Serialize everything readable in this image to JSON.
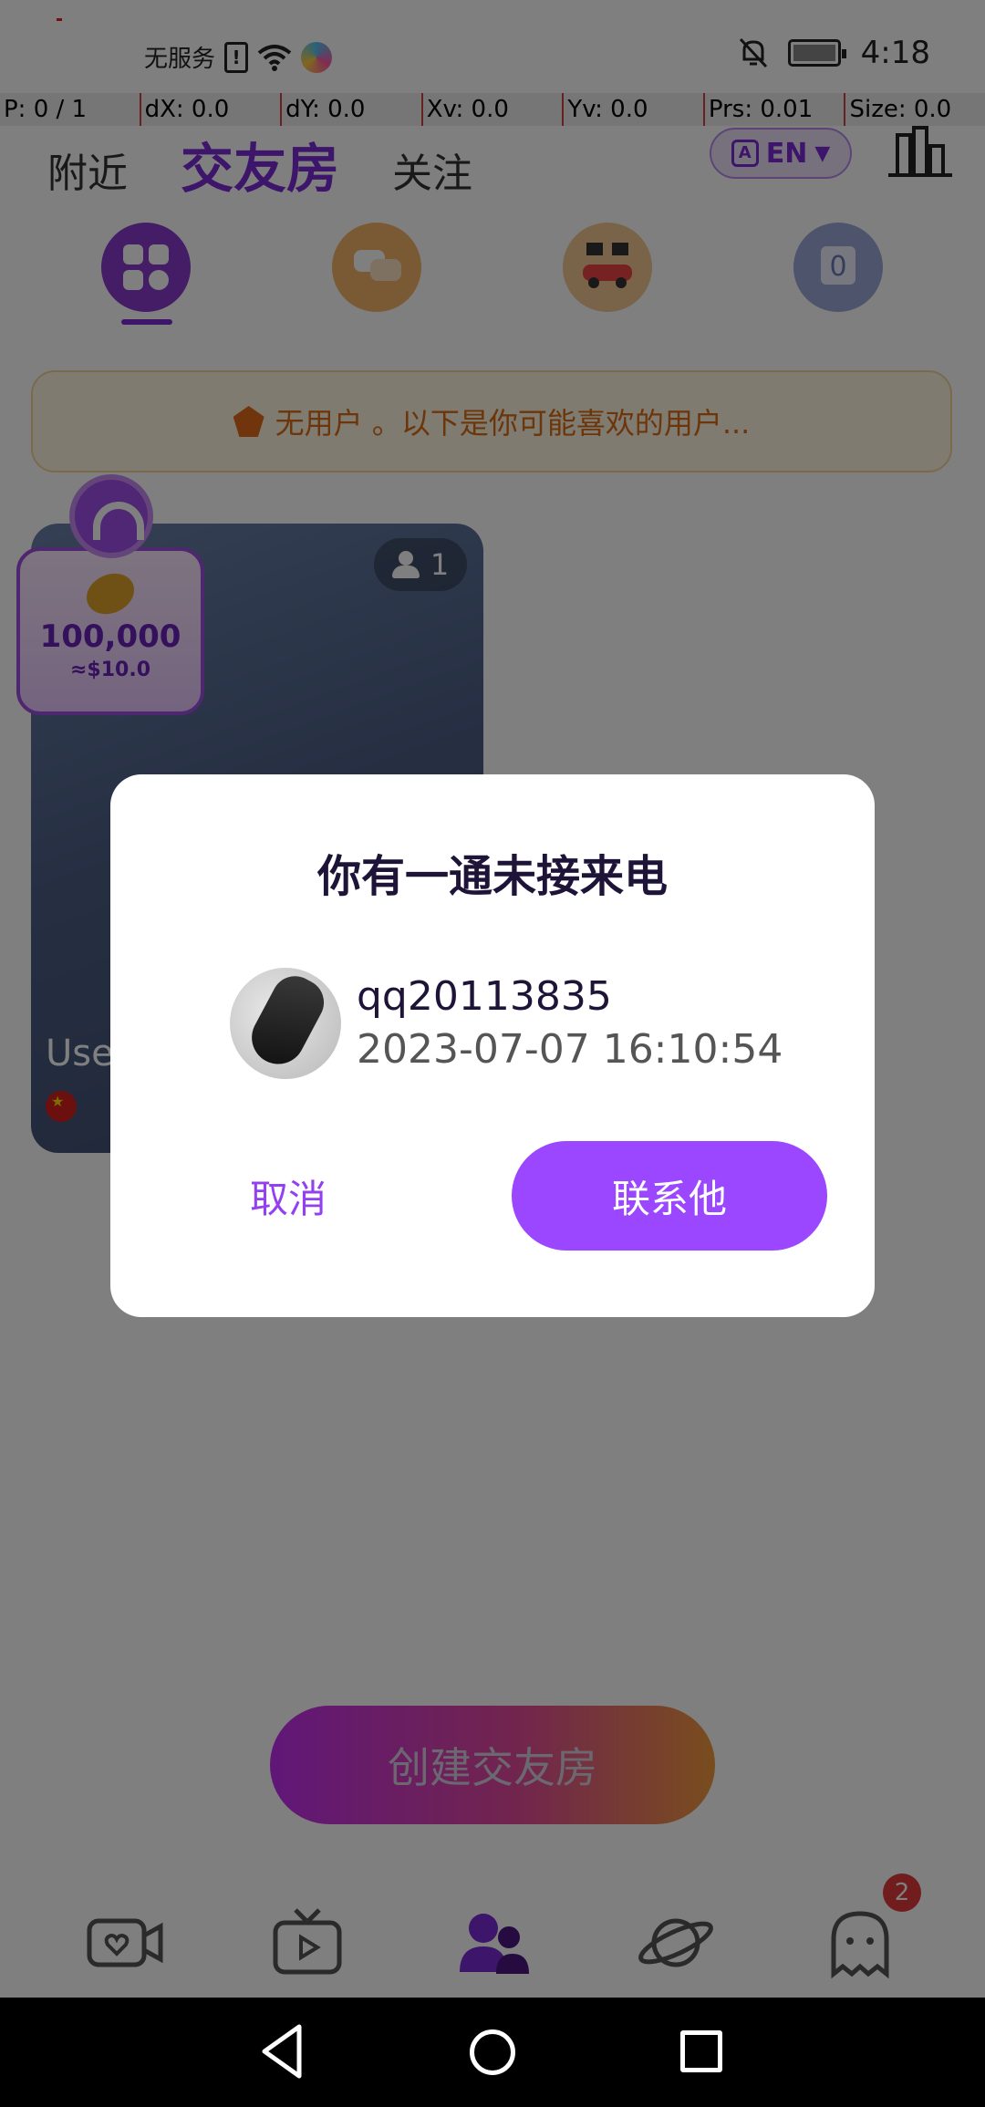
{
  "status_bar": {
    "carrier": "无服务",
    "time": "4:18"
  },
  "debug_bar": {
    "p": "P: 0 / 1",
    "dx": "dX: 0.0",
    "dy": "dY: 0.0",
    "xv": "Xv: 0.0",
    "yv": "Yv: 0.0",
    "prs": "Prs: 0.01",
    "size": "Size: 0.0"
  },
  "top_tabs": [
    {
      "label": "附近",
      "active": false
    },
    {
      "label": "交友房",
      "active": true
    },
    {
      "label": "关注",
      "active": false
    }
  ],
  "language": {
    "label": "EN",
    "icon": "translate-icon"
  },
  "categories": [
    {
      "icon": "grid-icon",
      "selected": true
    },
    {
      "icon": "chat-bubbles-icon",
      "selected": false
    },
    {
      "icon": "race-car-icon",
      "selected": false
    },
    {
      "icon": "number-puzzle-icon",
      "selected": false
    }
  ],
  "notice": {
    "text": "无用户 。以下是你可能喜欢的用户..."
  },
  "room_card": {
    "participant_count": "1",
    "username_partial": "Use",
    "flag": "china-flag-icon"
  },
  "coin_badge": {
    "amount": "100,000",
    "usd": "≈$10.0"
  },
  "create_button": {
    "label": "创建交友房"
  },
  "bottom_nav": {
    "items": [
      {
        "icon": "video-heart-icon"
      },
      {
        "icon": "tv-play-icon"
      },
      {
        "icon": "rooms-people-icon",
        "active": true
      },
      {
        "icon": "planet-icon"
      },
      {
        "icon": "ghost-message-icon"
      }
    ],
    "message_badge": "2"
  },
  "dialog": {
    "title": "你有一通未接来电",
    "caller_name": "qq20113835",
    "call_time": "2023-07-07 16:10:54",
    "cancel_label": "取消",
    "contact_label": "联系他"
  },
  "colors": {
    "accent": "#9b47ff",
    "brand_purple": "#7b2bd4",
    "notice_text": "#d86a14",
    "badge_red": "#e23b3b"
  }
}
